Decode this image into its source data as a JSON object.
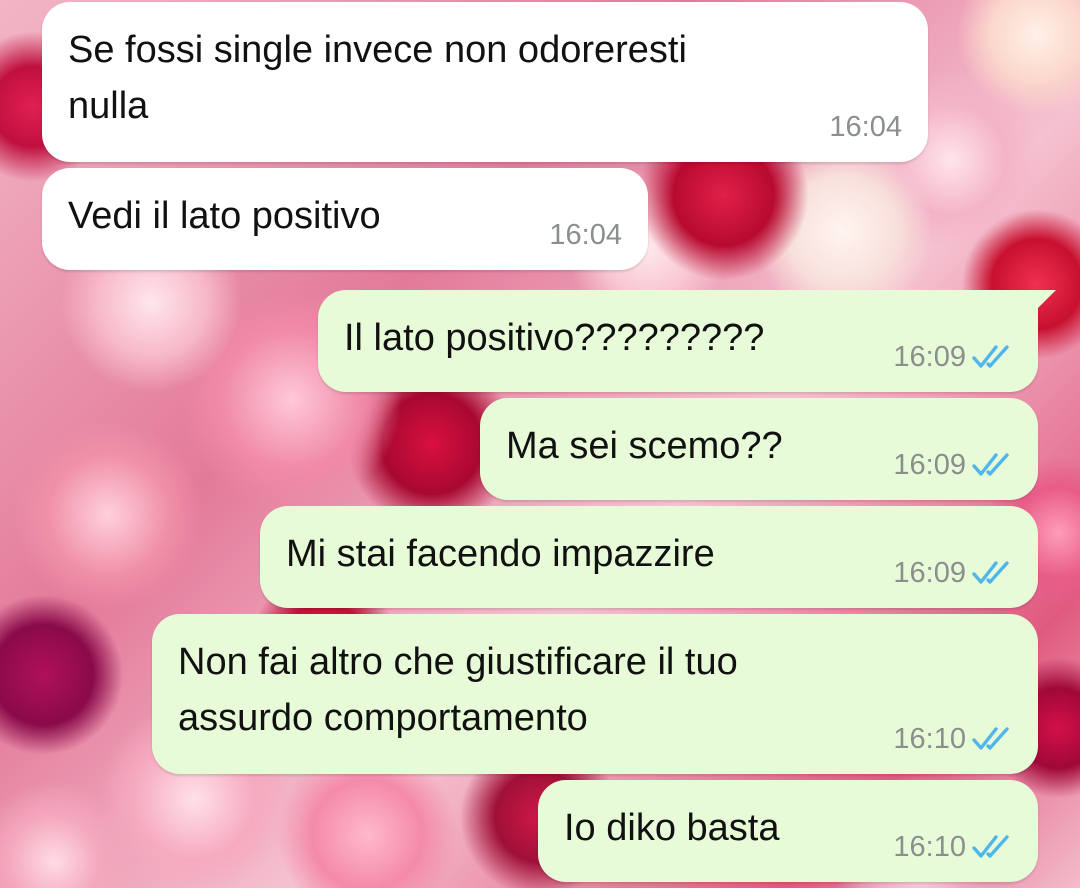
{
  "messages": [
    {
      "direction": "in",
      "text": "Se fossi single invece non odoreresti\nnulla",
      "time": "16:04"
    },
    {
      "direction": "in",
      "text": "Vedi il lato positivo",
      "time": "16:04"
    },
    {
      "direction": "out",
      "text": "Il lato positivo?????????",
      "time": "16:09",
      "status": "read-double-check"
    },
    {
      "direction": "out",
      "text": "Ma sei scemo??",
      "time": "16:09",
      "status": "read-double-check"
    },
    {
      "direction": "out",
      "text": "Mi stai facendo impazzire",
      "time": "16:09",
      "status": "read-double-check"
    },
    {
      "direction": "out",
      "text": "Non fai altro che giustificare il tuo\nassurdo comportamento",
      "time": "16:10",
      "status": "read-double-check"
    },
    {
      "direction": "out",
      "text": "Io diko basta",
      "time": "16:10",
      "status": "read-double-check"
    }
  ],
  "colors": {
    "incoming_bubble": "#ffffff",
    "outgoing_bubble": "#e8fbd8",
    "read_ticks": "#4fb6ec",
    "timestamp": "#8a8f8c"
  },
  "icons": {
    "wallpaper": "floral-wallpaper",
    "read_status": "double-check-icon"
  }
}
